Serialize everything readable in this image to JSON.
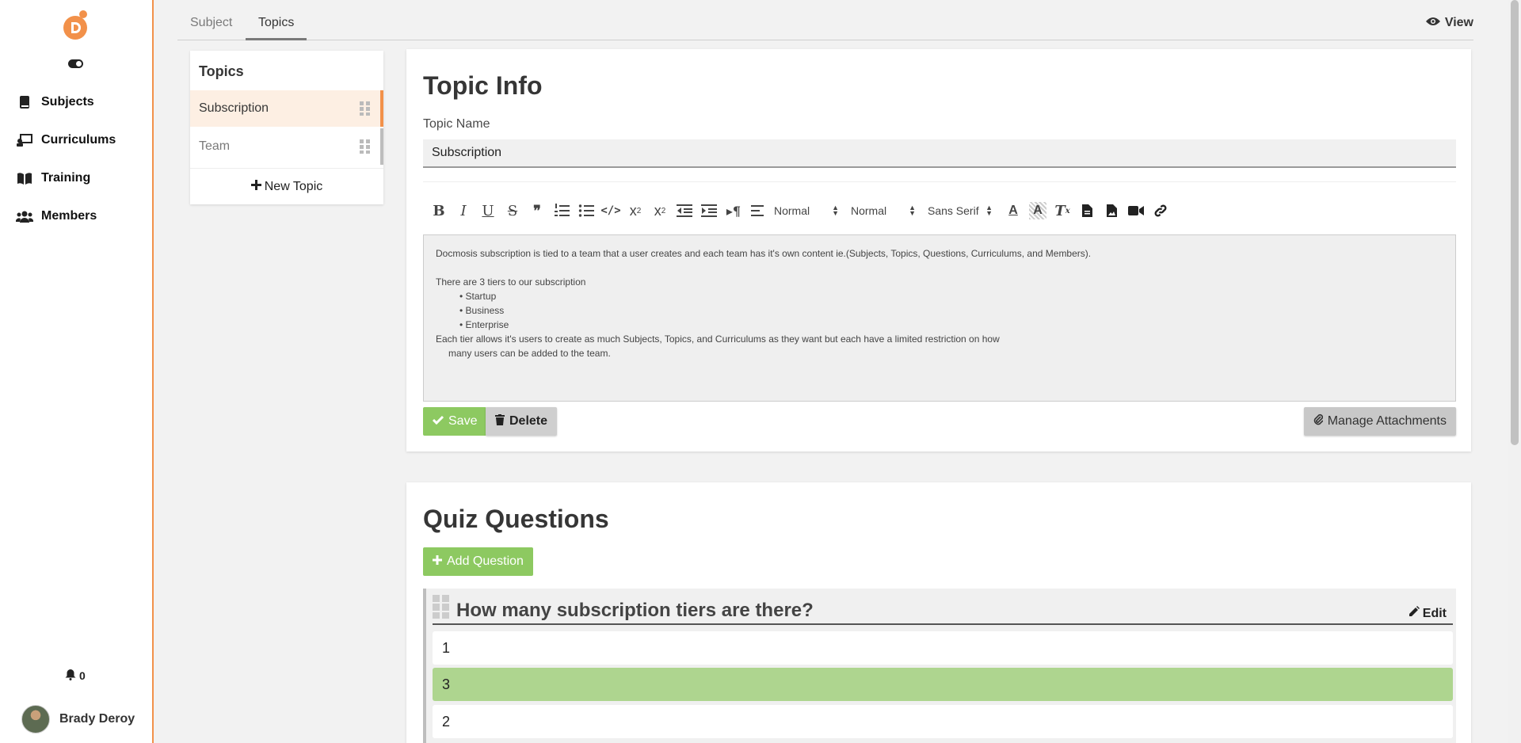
{
  "sidebar": {
    "logo_letter": "D",
    "nav": [
      {
        "label": "Subjects",
        "icon": "book-icon"
      },
      {
        "label": "Curriculums",
        "icon": "presentation-icon"
      },
      {
        "label": "Training",
        "icon": "open-book-icon"
      },
      {
        "label": "Members",
        "icon": "users-icon"
      }
    ],
    "notifications_count": "0",
    "user_name": "Brady Deroy"
  },
  "tabs": [
    {
      "label": "Subject"
    },
    {
      "label": "Topics",
      "active": true
    }
  ],
  "view_label": "View",
  "topics_panel": {
    "title": "Topics",
    "items": [
      {
        "label": "Subscription",
        "selected": true
      },
      {
        "label": "Team"
      }
    ],
    "new_topic_label": "New Topic"
  },
  "topic_info": {
    "title": "Topic Info",
    "name_label": "Topic Name",
    "name_value": "Subscription",
    "toolbar": {
      "size_select": "Normal",
      "header_select": "Normal",
      "font_select": "Sans Serif"
    },
    "editor_lines": [
      "Docmosis subscription is tied to a team that a user creates and each team has it's own content ie.(Subjects, Topics, Questions, Curriculums, and Members).",
      "",
      "There are 3 tiers to our subscription"
    ],
    "bullets": [
      "Startup",
      "Business",
      "Enterprise"
    ],
    "editor_after_1": "Each tier allows it's users to create as much Subjects, Topics, and Curriculums as they want but each have a limited restriction on how",
    "editor_after_2": "many users can be added to the team.",
    "save_label": "Save",
    "delete_label": "Delete",
    "attachments_label": "Manage Attachments"
  },
  "quiz": {
    "title": "Quiz Questions",
    "add_label": "Add Question",
    "question": "How many subscription tiers are there?",
    "edit_label": "Edit",
    "answers": [
      {
        "label": "1",
        "correct": false
      },
      {
        "label": "3",
        "correct": true
      },
      {
        "label": "2",
        "correct": false
      }
    ]
  },
  "colors": {
    "accent": "#f2914a",
    "success": "#8dc961",
    "correct_answer": "#aed58f"
  }
}
